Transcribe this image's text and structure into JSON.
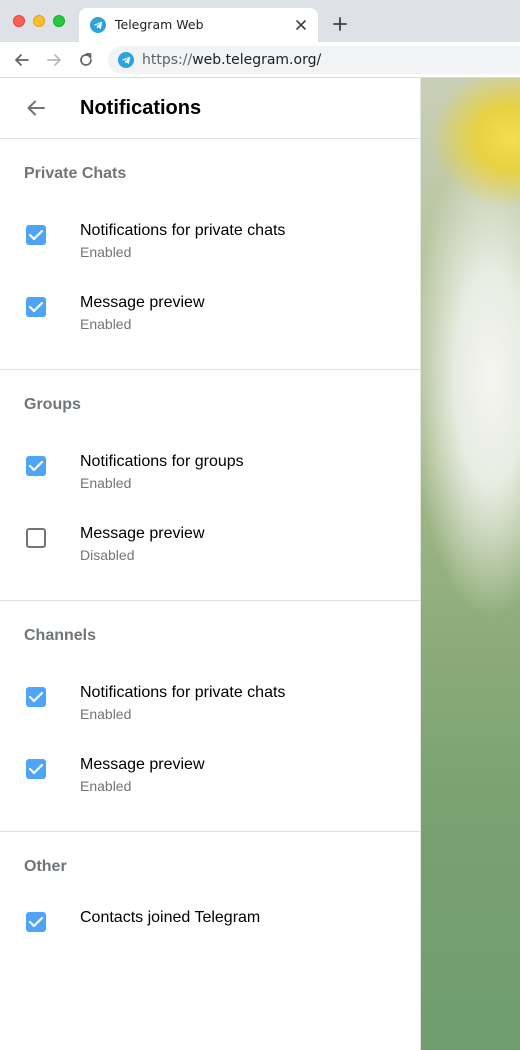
{
  "browser": {
    "tab_title": "Telegram Web",
    "url_scheme": "https://",
    "url_host": "web.telegram.org/"
  },
  "header": {
    "title": "Notifications"
  },
  "sections": [
    {
      "title": "Private Chats",
      "items": [
        {
          "label": "Notifications for private chats",
          "status": "Enabled",
          "checked": true
        },
        {
          "label": "Message preview",
          "status": "Enabled",
          "checked": true
        }
      ]
    },
    {
      "title": "Groups",
      "items": [
        {
          "label": "Notifications for groups",
          "status": "Enabled",
          "checked": true
        },
        {
          "label": "Message preview",
          "status": "Disabled",
          "checked": false
        }
      ]
    },
    {
      "title": "Channels",
      "items": [
        {
          "label": "Notifications for private chats",
          "status": "Enabled",
          "checked": true
        },
        {
          "label": "Message preview",
          "status": "Enabled",
          "checked": true
        }
      ]
    },
    {
      "title": "Other",
      "items": [
        {
          "label": "Contacts joined Telegram",
          "checked": true
        }
      ]
    }
  ],
  "colors": {
    "accent": "#4ea4f6",
    "secondary_text": "#707579"
  }
}
